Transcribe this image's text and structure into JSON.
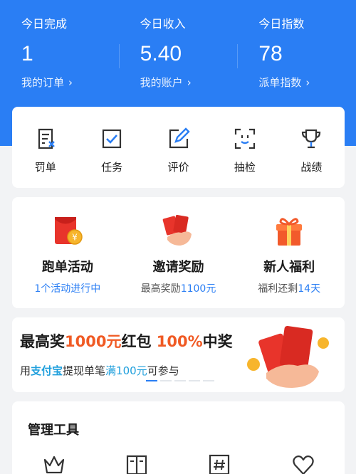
{
  "colors": {
    "header_blue": "#2a7ef4",
    "accent_red": "#f05a24",
    "alipay_blue": "#1f9fdc"
  },
  "stats": [
    {
      "label": "今日完成",
      "value": "1",
      "link": "我的订单"
    },
    {
      "label": "今日收入",
      "value": "5.40",
      "link": "我的账户"
    },
    {
      "label": "今日指数",
      "value": "78",
      "link": "派单指数"
    }
  ],
  "quick_actions": [
    {
      "label": "罚单",
      "icon": "penalty-doc-icon"
    },
    {
      "label": "任务",
      "icon": "task-check-icon"
    },
    {
      "label": "评价",
      "icon": "edit-review-icon"
    },
    {
      "label": "抽检",
      "icon": "face-scan-icon"
    },
    {
      "label": "战绩",
      "icon": "trophy-icon"
    }
  ],
  "activities": [
    {
      "title": "跑单活动",
      "sub_a": "1个活动进行中",
      "sub_b": "",
      "sub_c": "",
      "icon": "red-envelope-coin-icon"
    },
    {
      "title": "邀请奖励",
      "sub_a": "最高奖励",
      "sub_b": "1100元",
      "sub_c": "",
      "icon": "hand-envelopes-icon"
    },
    {
      "title": "新人福利",
      "sub_a": "福利还剩",
      "sub_b": "14天",
      "sub_c": "",
      "icon": "gift-box-icon"
    }
  ],
  "banner": {
    "t1": "最高奖",
    "t2": "1000元",
    "t3": "红包 ",
    "t4": "100%",
    "t5": "中奖",
    "s1": "用",
    "s2": "支付宝",
    "s3": "提现单笔",
    "s4": "满100元",
    "s5": "可参与",
    "active_slide": 1,
    "slide_count": 5
  },
  "management": {
    "title": "管理工具",
    "tools": [
      {
        "icon": "crown-icon"
      },
      {
        "icon": "book-icon"
      },
      {
        "icon": "hashtag-icon"
      },
      {
        "icon": "heart-icon"
      }
    ]
  }
}
